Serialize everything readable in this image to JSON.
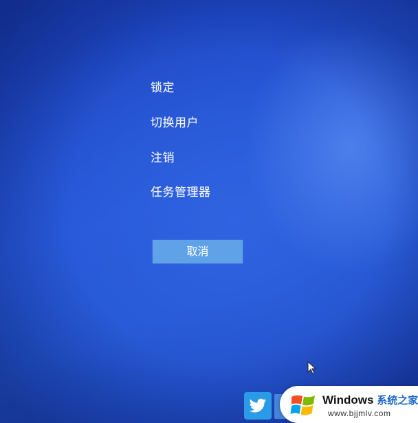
{
  "menu": {
    "lock": "锁定",
    "switch_user": "切换用户",
    "sign_out": "注销",
    "task_manager": "任务管理器"
  },
  "cancel_button": {
    "label": "取消"
  },
  "watermark": {
    "brand": "Windows",
    "brand_suffix": "系统之家",
    "url": "www.bjjmlv.com"
  },
  "colors": {
    "background": "#2555d6",
    "cancel_button": "#5fa2e8",
    "menu_text": "#f2f5ff"
  },
  "icons": {
    "cursor": "mouse-pointer-icon",
    "twitter": "twitter-bird-icon",
    "windows_logo": "windows-logo-icon"
  }
}
